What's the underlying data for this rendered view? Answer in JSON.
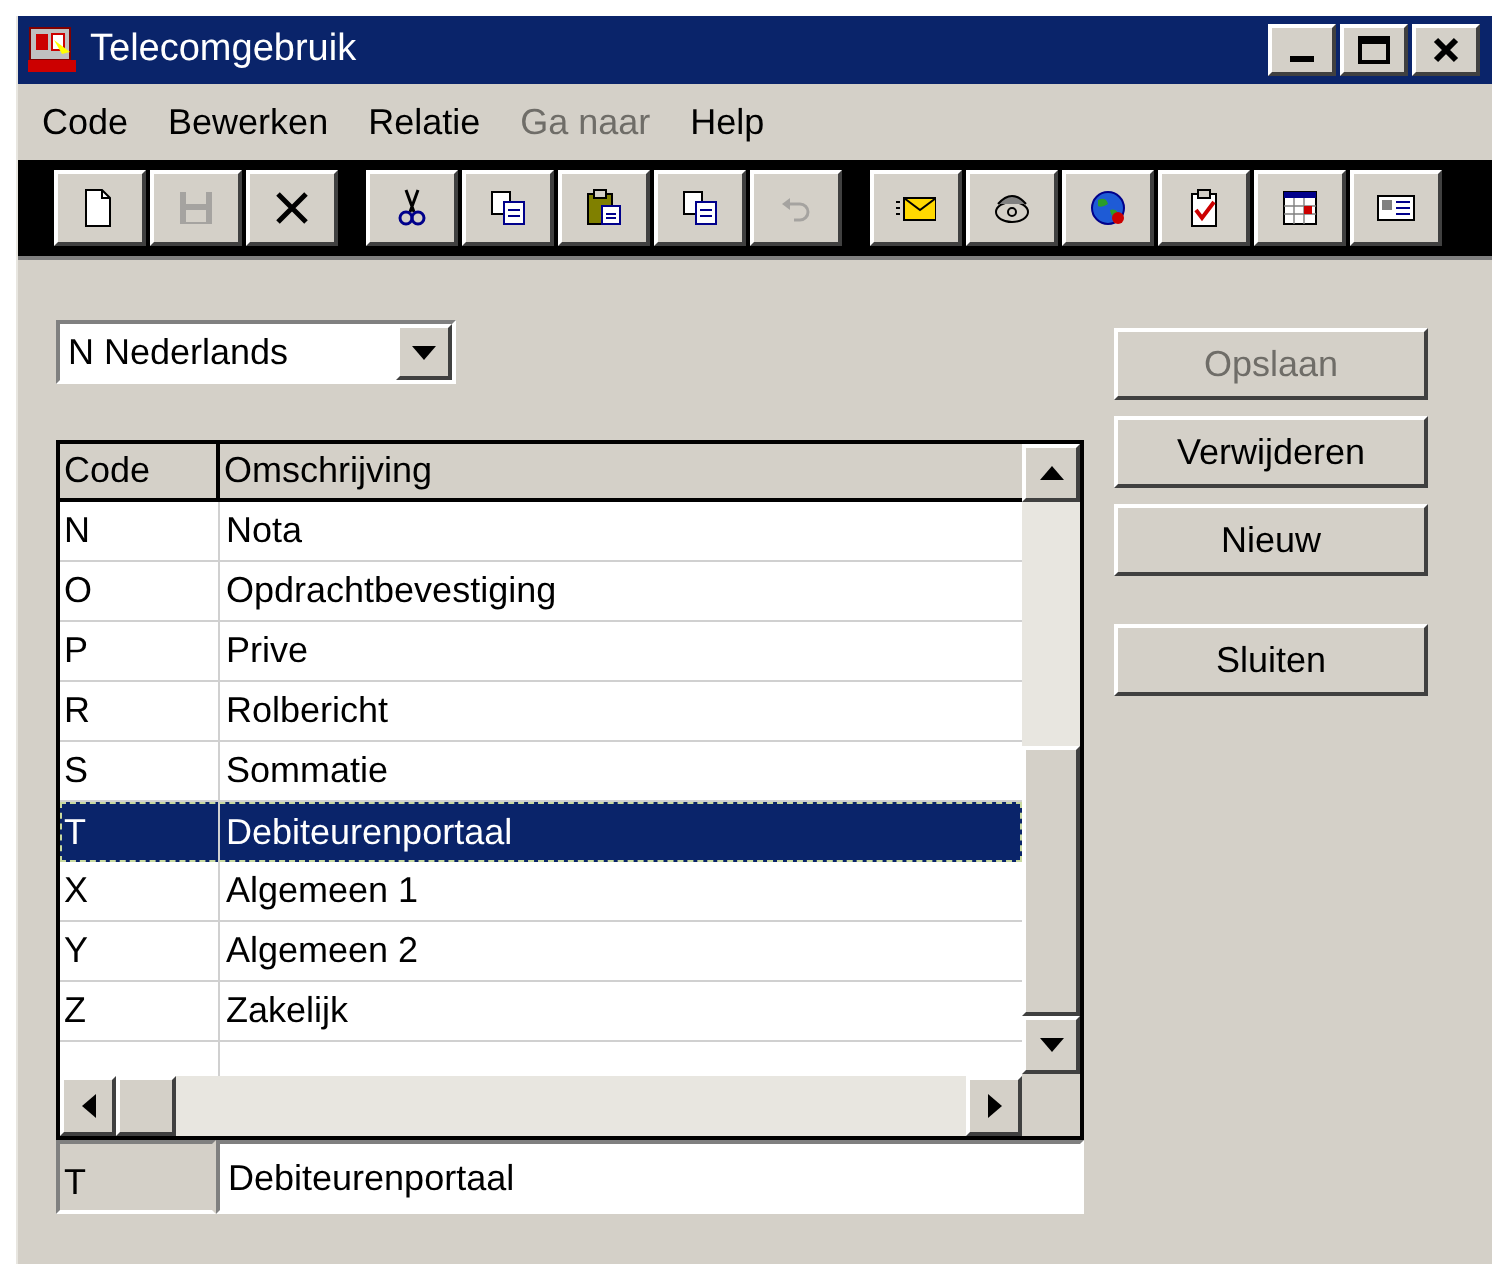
{
  "window": {
    "title": "Telecomgebruik"
  },
  "menu": [
    {
      "label": "Code",
      "disabled": false
    },
    {
      "label": "Bewerken",
      "disabled": false
    },
    {
      "label": "Relatie",
      "disabled": false
    },
    {
      "label": "Ga naar",
      "disabled": true
    },
    {
      "label": "Help",
      "disabled": false
    }
  ],
  "toolbar": [
    [
      {
        "kind": "new",
        "disabled": false
      },
      {
        "kind": "save",
        "disabled": true
      },
      {
        "kind": "delete",
        "disabled": false
      }
    ],
    [
      {
        "kind": "cut",
        "disabled": false
      },
      {
        "kind": "copy",
        "disabled": false
      },
      {
        "kind": "paste",
        "disabled": false
      },
      {
        "kind": "copy",
        "disabled": false
      },
      {
        "kind": "undo",
        "disabled": true
      }
    ],
    [
      {
        "kind": "mail",
        "disabled": false
      },
      {
        "kind": "phone",
        "disabled": false
      },
      {
        "kind": "globe",
        "disabled": false
      },
      {
        "kind": "checklist",
        "disabled": false
      },
      {
        "kind": "calendar",
        "disabled": false
      },
      {
        "kind": "card",
        "disabled": false
      }
    ]
  ],
  "language_dropdown": {
    "value": "N Nederlands"
  },
  "table": {
    "columns": [
      "Code",
      "Omschrijving"
    ],
    "rows": [
      {
        "code": "N",
        "description": "Nota",
        "selected": false
      },
      {
        "code": "O",
        "description": "Opdrachtbevestiging",
        "selected": false
      },
      {
        "code": "P",
        "description": "Prive",
        "selected": false
      },
      {
        "code": "R",
        "description": "Rolbericht",
        "selected": false
      },
      {
        "code": "S",
        "description": "Sommatie",
        "selected": false
      },
      {
        "code": "T",
        "description": "Debiteurenportaal",
        "selected": true
      },
      {
        "code": "X",
        "description": "Algemeen 1",
        "selected": false
      },
      {
        "code": "Y",
        "description": "Algemeen 2",
        "selected": false
      },
      {
        "code": "Z",
        "description": "Zakelijk",
        "selected": false
      }
    ]
  },
  "edit_row": {
    "code": "T",
    "description": "Debiteurenportaal"
  },
  "buttons": [
    {
      "label": "Opslaan",
      "disabled": true
    },
    {
      "label": "Verwijderen",
      "disabled": false
    },
    {
      "label": "Nieuw",
      "disabled": false
    },
    {
      "label": "Sluiten",
      "disabled": false
    }
  ]
}
